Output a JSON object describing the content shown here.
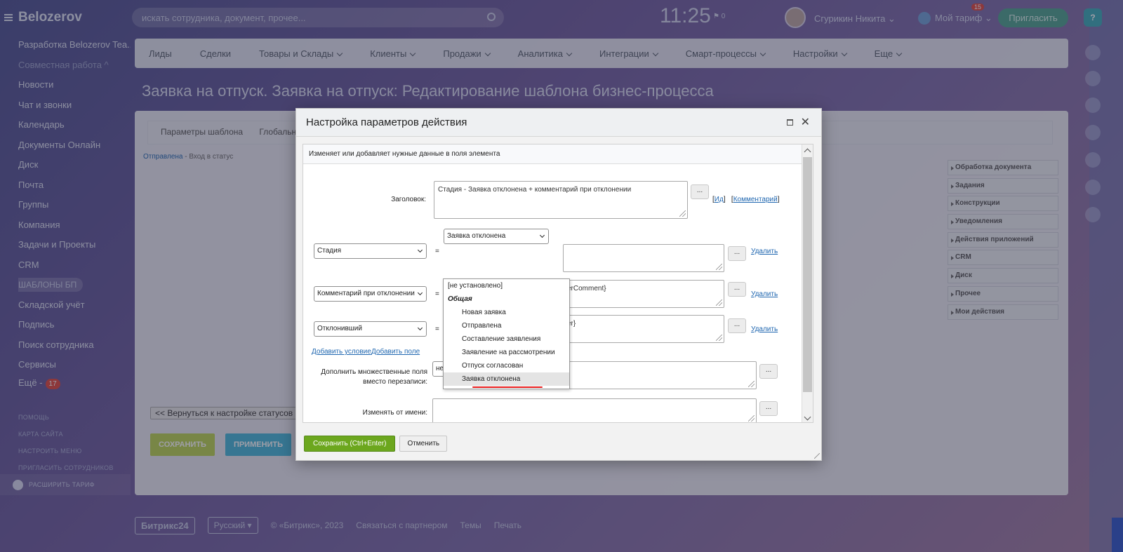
{
  "portal": {
    "name": "Belozerov",
    "menu": [
      {
        "label": "Разработка Belozerov Tea...",
        "style": "normal"
      },
      {
        "label": "Совместная работа ^",
        "style": "dim"
      },
      {
        "label": "Новости",
        "style": "normal"
      },
      {
        "label": "Чат и звонки",
        "style": "normal"
      },
      {
        "label": "Календарь",
        "style": "normal"
      },
      {
        "label": "Документы Онлайн",
        "style": "normal"
      },
      {
        "label": "Диск",
        "style": "normal"
      },
      {
        "label": "Почта",
        "style": "normal"
      },
      {
        "label": "Группы",
        "style": "normal"
      },
      {
        "label": "Компания",
        "style": "normal"
      },
      {
        "label": "Задачи и Проекты",
        "style": "normal"
      },
      {
        "label": "CRM",
        "style": "normal"
      },
      {
        "label": "ШАБЛОНЫ БП",
        "style": "pill"
      },
      {
        "label": "Складской учёт",
        "style": "normal"
      },
      {
        "label": "Подпись",
        "style": "normal"
      },
      {
        "label": "Поиск сотрудника",
        "style": "normal"
      },
      {
        "label": "Сервисы",
        "style": "normal"
      }
    ],
    "more_label": "Ещё -",
    "more_count": "17",
    "small_links": [
      "ПОМОЩЬ",
      "КАРТА САЙТА",
      "НАСТРОИТЬ МЕНЮ",
      "ПРИГЛАСИТЬ СОТРУДНИКОВ"
    ],
    "upgrade_label": "РАСШИРИТЬ ТАРИФ"
  },
  "header": {
    "search_placeholder": "искать сотрудника, документ, прочее...",
    "time": "11:25",
    "flag_count": "0",
    "user_name": "Сгурикин Никита",
    "tariff_label": "Мой тариф",
    "tariff_count": "15",
    "invite_label": "Пригласить",
    "help_label": "?"
  },
  "topnav": [
    "Лиды",
    "Сделки",
    "Товары и Склады",
    "Клиенты",
    "Продажи",
    "Аналитика",
    "Интеграции",
    "Смарт-процессы",
    "Настройки",
    "Еще"
  ],
  "page": {
    "title": "Заявка на отпуск. Заявка на отпуск: Редактирование шаблона бизнес-процесса",
    "tab1": "Параметры шаблона",
    "tab2": "Глобальны",
    "crumb_link": "Отправлена",
    "crumb_text": " - Вход в статус",
    "back_button": "<< Вернуться к настройке статусов",
    "save_button": "СОХРАНИТЬ",
    "apply_button": "ПРИМЕНИТЬ",
    "activities": [
      "Обработка документа",
      "Задания",
      "Конструкции",
      "Уведомления",
      "Действия приложений",
      "CRM",
      "Диск",
      "Прочее",
      "Мои действия"
    ]
  },
  "footer": {
    "brand": "Битрикс24",
    "lang": "Русский",
    "copyright": "© «Битрикс», 2023",
    "partner": "Связаться с партнером",
    "themes": "Темы",
    "print": "Печать"
  },
  "dialog": {
    "title": "Настройка параметров действия",
    "description": "Изменяет или добавляет нужные данные в поля элемента",
    "title_label": "Заголовок:",
    "title_value": "Стадия - Заявка отклонена + комментарий при отклонении",
    "dots": "...",
    "id_link": "Ид",
    "comment_link": "Комментарий",
    "selected_value": "Заявка отклонена",
    "rows": [
      {
        "field": "Стадия",
        "value": "",
        "delete": "Удалить"
      },
      {
        "field": "Комментарий при отклонении",
        "value": "erComment}",
        "delete": "Удалить"
      },
      {
        "field": "Отклонивший",
        "value": "er}",
        "delete": "Удалить"
      }
    ],
    "equals": "=",
    "add_condition": "Добавить условие",
    "add_field": "Добавить поле",
    "multi_label_1": "Дополнить множественные поля",
    "multi_label_2": "вместо перезаписи:",
    "multi_value": "нет",
    "change_as_label": "Изменять от имени:",
    "dropdown": [
      {
        "label": "[не установлено]",
        "kind": "plain"
      },
      {
        "label": "Общая",
        "kind": "group"
      },
      {
        "label": "Новая заявка",
        "kind": "opt"
      },
      {
        "label": "Отправлена",
        "kind": "opt"
      },
      {
        "label": "Составление заявления",
        "kind": "opt"
      },
      {
        "label": "Заявление на рассмотрении",
        "kind": "opt"
      },
      {
        "label": "Отпуск согласован",
        "kind": "opt"
      },
      {
        "label": "Заявка отклонена",
        "kind": "opt-hl"
      }
    ],
    "save_button": "Сохранить (Ctrl+Enter)",
    "cancel_button": "Отменить"
  }
}
